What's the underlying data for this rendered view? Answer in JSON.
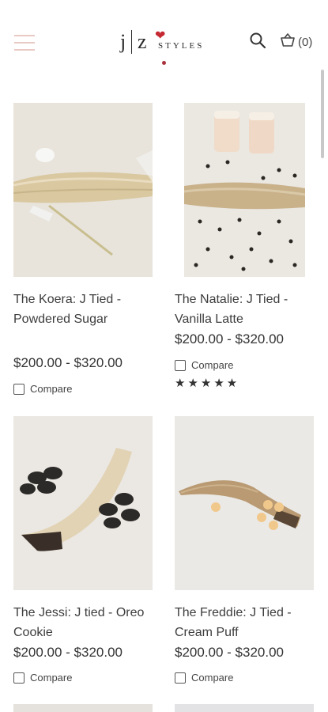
{
  "header": {
    "logo": {
      "j": "j",
      "z": "z",
      "styles": "STYLES"
    },
    "cart_count": "(0)"
  },
  "products": [
    {
      "title": "The Koera: J Tied - Powdered Sugar",
      "price": "$200.00 - $320.00",
      "compare_label": "Compare"
    },
    {
      "title": "The Natalie: J Tied - Vanilla Latte",
      "price": "$200.00 - $320.00",
      "compare_label": "Compare",
      "rating": "★★★★★"
    },
    {
      "title": "The Jessi: J tied - Oreo Cookie",
      "price": "$200.00 - $320.00",
      "compare_label": "Compare"
    },
    {
      "title": "The Freddie: J Tied - Cream Puff",
      "price": "$200.00 - $320.00",
      "compare_label": "Compare"
    }
  ],
  "colors": {
    "logo_heart": "#c52a33",
    "hamburger": "#e8c9c4"
  }
}
